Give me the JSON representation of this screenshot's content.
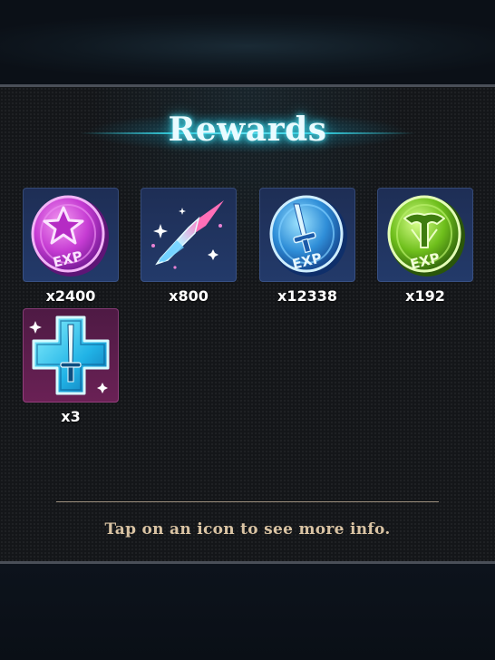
{
  "title": "Rewards",
  "rewards": [
    {
      "icon": "purple-star-exp-coin-icon",
      "count": "x2400",
      "exp_label": "EXP"
    },
    {
      "icon": "crystal-shard-icon",
      "count": "x800"
    },
    {
      "icon": "blue-sword-exp-coin-icon",
      "count": "x12338",
      "exp_label": "EXP"
    },
    {
      "icon": "green-emblem-exp-coin-icon",
      "count": "x192",
      "exp_label": "EXP"
    },
    {
      "icon": "blue-cross-sword-icon",
      "count": "x3"
    }
  ],
  "hint": "Tap on an icon to see more info.",
  "colors": {
    "title_glow": "#38d6e6",
    "hint": "#d9c3a3",
    "tile": "#1e2e55",
    "tile_special": "#5a1d4c"
  }
}
